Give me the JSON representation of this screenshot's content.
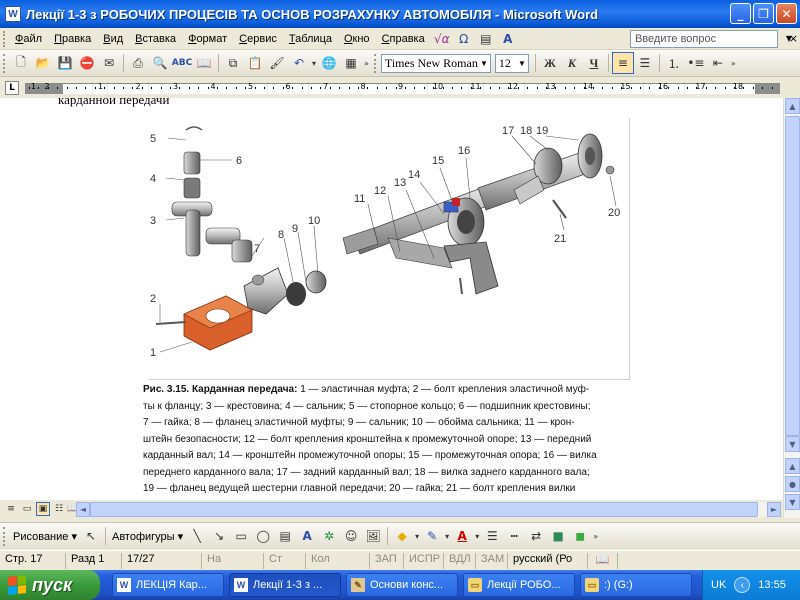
{
  "window": {
    "title": "Лекції 1-3 з РОБОЧИХ ПРОЦЕСІВ ТА ОСНОВ РОЗРАХУНКУ АВТОМОБІЛЯ - Microsoft Word",
    "app_icon": "W",
    "controls": {
      "minimize": "_",
      "maximize": "❐",
      "close": "✕"
    }
  },
  "menubar": {
    "items": [
      {
        "label": "Файл"
      },
      {
        "label": "Правка"
      },
      {
        "label": "Вид"
      },
      {
        "label": "Вставка"
      },
      {
        "label": "Формат"
      },
      {
        "label": "Сервис"
      },
      {
        "label": "Таблица"
      },
      {
        "label": "Окно"
      },
      {
        "label": "Справка"
      }
    ],
    "ask_placeholder": "Введите вопрос",
    "close_glyph": "×"
  },
  "toolbar": {
    "font_name": "Times New Roman",
    "font_size": "12",
    "bold": "Ж",
    "italic": "К",
    "underline": "Ч"
  },
  "ruler": {
    "tab_selector": "L",
    "numbers": [
      "1",
      "2",
      "1",
      "2",
      "3",
      "4",
      "5",
      "6",
      "7",
      "8",
      "9",
      "10",
      "11",
      "12",
      "13",
      "14",
      "15",
      "16",
      "17",
      "18"
    ]
  },
  "document": {
    "previous_line": "карданной передачи",
    "caption_title": "Рис. 3.15. Карданная передача:",
    "caption_lines": [
      "1 — эластичная муфта; 2 — болт крепления эластичной муф-",
      "ты к фланцу; 3 — крестовина; 4 — сальник; 5 — стопорное кольцо; 6 — подшипник крестовины;",
      "7 — гайка; 8 — фланец эластичной муфты; 9 — сальник; 10 — обойма сальника; 11 — крон-",
      "штейн безопасности; 12 — болт крепления кронштейна к промежуточной опоре; 13 — передний",
      "карданный вал; 14 — кронштейн промежуточной опоры; 15 — промежуточная опора; 16 — вилка",
      "переднего карданного вала; 17 — задний карданный вал; 18 — вилка заднего карданного вала;",
      "19 — фланец ведущей шестерни главной передачи; 20 — гайка; 21 — болт крепления вилки"
    ],
    "figure_labels": [
      "5",
      "6",
      "4",
      "3",
      "7",
      "8",
      "9",
      "10",
      "11",
      "12",
      "13",
      "14",
      "15",
      "16",
      "17",
      "18",
      "19",
      "20",
      "21",
      "2",
      "1"
    ]
  },
  "drawbar": {
    "draw_label": "Рисование",
    "autoshapes_label": "Автофигуры"
  },
  "statusbar": {
    "page": "Стр. 17",
    "section": "Разд 1",
    "page_of": "17/27",
    "at": "На",
    "line": "Ст",
    "col": "Кол",
    "rec": "ЗАП",
    "trk": "ИСПР",
    "ext": "ВДЛ",
    "ovr": "ЗАМ",
    "language": "русский (Ро"
  },
  "taskbar": {
    "start_label": "пуск",
    "tasks": [
      {
        "label": "ЛЕКЦІЯ Кар...",
        "icon": "word"
      },
      {
        "label": "Лекції 1-3 з ...",
        "icon": "word"
      },
      {
        "label": "Основи конс...",
        "icon": "pen"
      },
      {
        "label": "Лекції РОБО...",
        "icon": "folder"
      },
      {
        "label": ":)     (G:)",
        "icon": "folder"
      }
    ],
    "tray_lang": "UK",
    "tray_arrow": "‹",
    "clock": "13:55"
  },
  "colors": {
    "titlebar": "#0A5FE0",
    "taskbar": "#245EDB",
    "start": "#3A9A3A",
    "part_orange": "#D9602A",
    "part_blue": "#3A5FC8",
    "part_red": "#C8202A"
  }
}
